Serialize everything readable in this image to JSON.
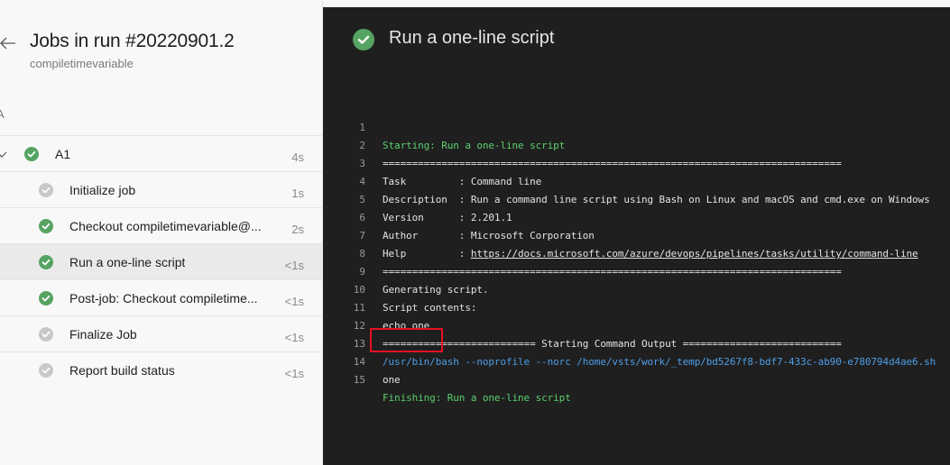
{
  "header": {
    "title": "Jobs in run #20220901.2",
    "subtitle": "compiletimevariable",
    "back_icon": "arrow-left-icon"
  },
  "stage": {
    "label": "A"
  },
  "job": {
    "name": "A1",
    "duration": "4s",
    "status": "succeeded",
    "expanded": true
  },
  "steps": [
    {
      "name": "Initialize job",
      "duration": "1s",
      "status": "succeeded-grey",
      "selected": false
    },
    {
      "name": "Checkout compiletimevariable@...",
      "duration": "2s",
      "status": "succeeded",
      "selected": false
    },
    {
      "name": "Run a one-line script",
      "duration": "<1s",
      "status": "succeeded",
      "selected": true
    },
    {
      "name": "Post-job: Checkout compiletime...",
      "duration": "<1s",
      "status": "succeeded",
      "selected": false
    },
    {
      "name": "Finalize Job",
      "duration": "<1s",
      "status": "succeeded-grey",
      "selected": false
    },
    {
      "name": "Report build status",
      "duration": "<1s",
      "status": "succeeded-grey",
      "selected": false
    }
  ],
  "log": {
    "title": "Run a one-line script",
    "status": "succeeded",
    "lines": [
      {
        "n": "1",
        "text": "Starting: Run a one-line script",
        "style": "green"
      },
      {
        "n": "2",
        "text": "==============================================================================",
        "style": "normal"
      },
      {
        "n": "3",
        "text": "Task         : Command line",
        "style": "normal"
      },
      {
        "n": "4",
        "text": "Description  : Run a command line script using Bash on Linux and macOS and cmd.exe on Windows",
        "style": "normal"
      },
      {
        "n": "5",
        "text": "Version      : 2.201.1",
        "style": "normal"
      },
      {
        "n": "6",
        "text": "Author       : Microsoft Corporation",
        "style": "normal"
      },
      {
        "n": "7",
        "text_prefix": "Help         : ",
        "link": "https://docs.microsoft.com/azure/devops/pipelines/tasks/utility/command-line",
        "style": "normal"
      },
      {
        "n": "8",
        "text": "==============================================================================",
        "style": "normal"
      },
      {
        "n": "9",
        "text": "Generating script.",
        "style": "normal"
      },
      {
        "n": "10",
        "text": "Script contents:",
        "style": "normal"
      },
      {
        "n": "11",
        "text": "echo one",
        "style": "normal"
      },
      {
        "n": "12",
        "text": "========================== Starting Command Output ===========================",
        "style": "normal"
      },
      {
        "n": "13",
        "text": "/usr/bin/bash --noprofile --norc /home/vsts/work/_temp/bd5267f8-bdf7-433c-ab90-e780794d4ae6.sh",
        "style": "blue"
      },
      {
        "n": "14",
        "text": "one",
        "style": "normal"
      },
      {
        "n": "15",
        "text": "Finishing: Run a one-line script",
        "style": "green"
      }
    ],
    "highlighted_line": "14"
  },
  "colors": {
    "success": "#55a362",
    "success_grey": "#c8c8c8",
    "log_green": "#5ad06e",
    "log_blue": "#4e9ee8",
    "highlight_red": "#e81123",
    "log_bg": "#1f1f1f"
  }
}
